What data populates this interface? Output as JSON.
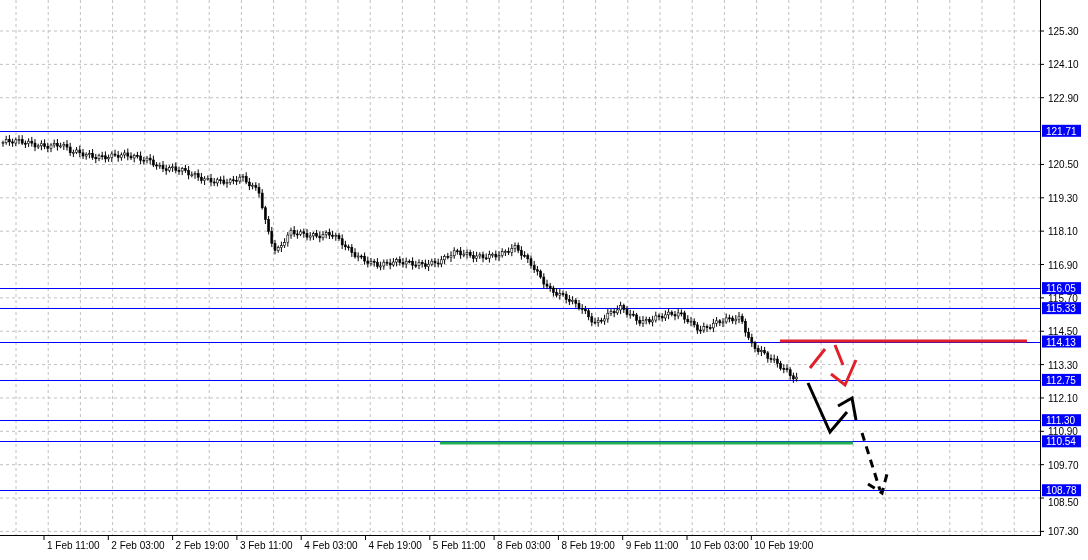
{
  "price_axis": {
    "ticks": [
      "125.30",
      "124.10",
      "122.90",
      "120.50",
      "119.30",
      "118.10",
      "116.90",
      "115.70",
      "114.50",
      "113.30",
      "112.10",
      "110.90",
      "109.70",
      "108.50",
      "107.30"
    ]
  },
  "levels": [
    {
      "label": "121.71"
    },
    {
      "label": "116.05"
    },
    {
      "label": "115.33"
    },
    {
      "label": "114.13"
    },
    {
      "label": "112.75"
    },
    {
      "label": "111.30"
    },
    {
      "label": "110.54"
    },
    {
      "label": "108.78"
    }
  ],
  "time_axis": {
    "ticks": [
      "1 Feb 11:00",
      "2 Feb 03:00",
      "2 Feb 19:00",
      "3 Feb 11:00",
      "4 Feb 03:00",
      "4 Feb 19:00",
      "5 Feb 11:00",
      "8 Feb 03:00",
      "8 Feb 19:00",
      "9 Feb 11:00",
      "10 Feb 03:00",
      "10 Feb 19:00"
    ]
  }
}
